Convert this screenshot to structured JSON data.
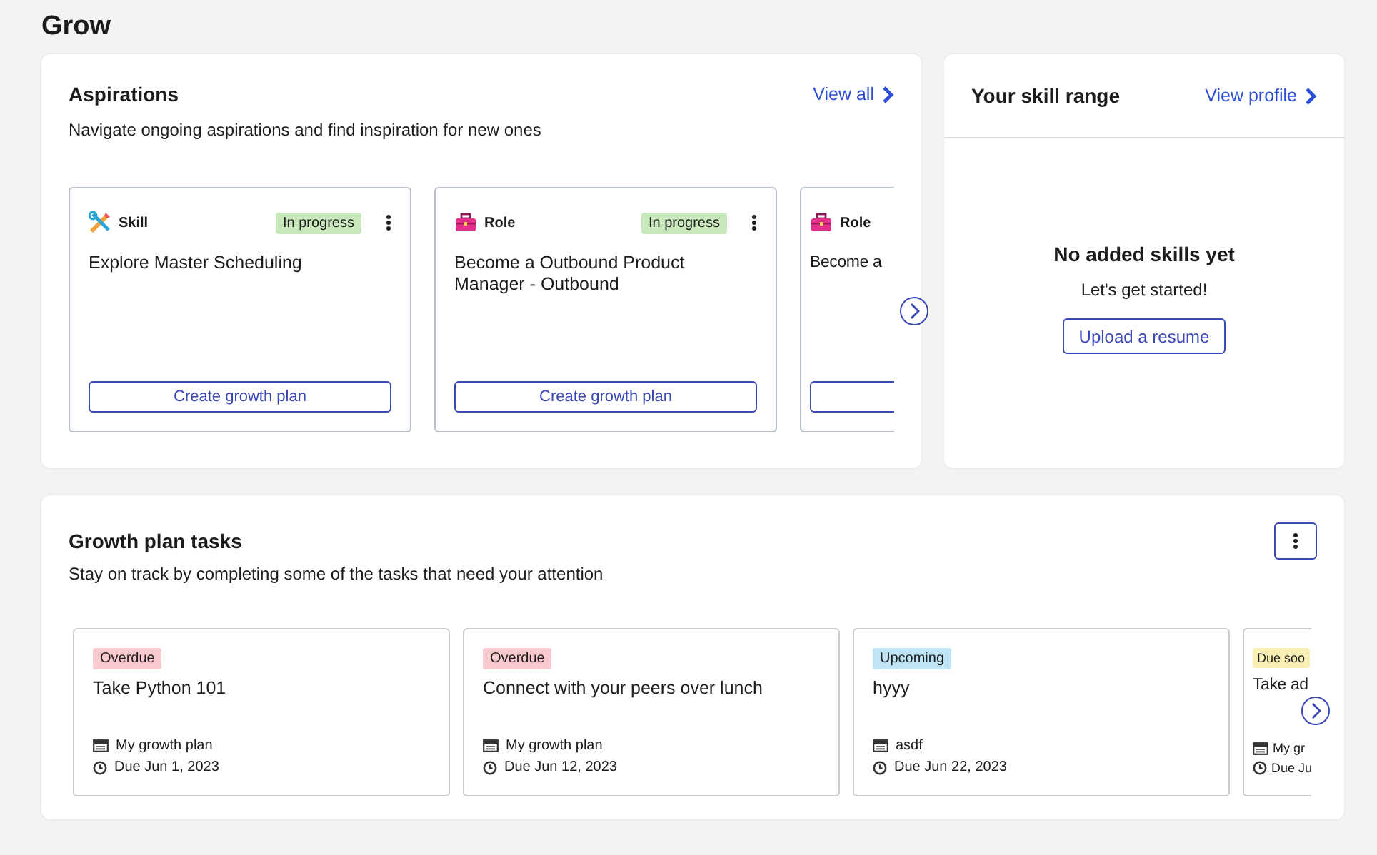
{
  "page_title": "Grow",
  "aspirations": {
    "title": "Aspirations",
    "link": "View all",
    "subtitle": "Navigate ongoing aspirations and find inspiration for new ones",
    "cards": [
      {
        "kind": "skill",
        "type_label": "Skill",
        "status": "In progress",
        "title": "Explore Master Scheduling",
        "button": "Create growth plan"
      },
      {
        "kind": "role",
        "type_label": "Role",
        "status": "In progress",
        "title": "Become a Outbound Product Manager - Outbound",
        "button": "Create growth plan"
      },
      {
        "kind": "role",
        "type_label": "Role",
        "title": "Become a",
        "button_outline": true
      }
    ]
  },
  "skill_range": {
    "title": "Your skill range",
    "link": "View profile",
    "empty_title": "No added skills yet",
    "empty_text": "Let's get started!",
    "button": "Upload a resume"
  },
  "tasks": {
    "title": "Growth plan tasks",
    "subtitle": "Stay on track by completing some of the tasks that need your attention",
    "cards": [
      {
        "color": "#f8c9cf",
        "status": "Overdue",
        "title": "Take Python 101",
        "plan": "My growth plan",
        "due": "Due Jun 1, 2023"
      },
      {
        "color": "#f8c9cf",
        "status": "Overdue",
        "title": "Connect with your peers over lunch",
        "plan": "My growth plan",
        "due": "Due Jun 12, 2023"
      },
      {
        "color": "#bfe4f5",
        "status": "Upcoming",
        "title": "hyyy",
        "plan": "asdf",
        "due": "Due Jun 22, 2023"
      },
      {
        "color": "#f8efb5",
        "status": "Due soo",
        "title": "Take ad",
        "plan": "My gr",
        "due": "Due Ju"
      }
    ]
  }
}
